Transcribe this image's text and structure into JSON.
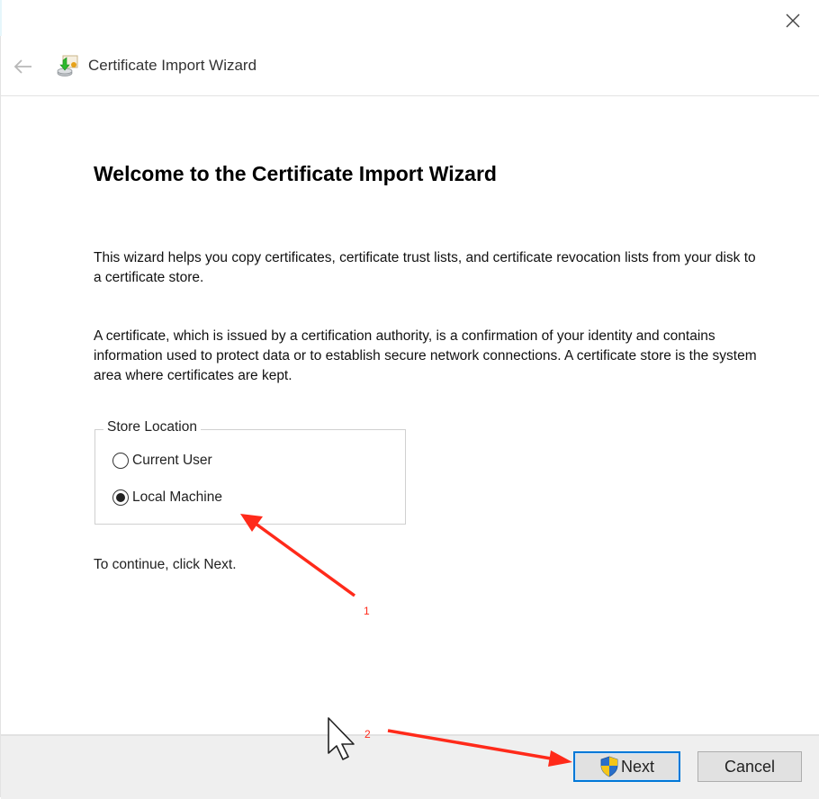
{
  "window": {
    "close_icon": "close-icon"
  },
  "header": {
    "back_icon": "back-arrow-icon",
    "app_icon": "certificate-wizard-icon",
    "title": "Certificate Import Wizard"
  },
  "main": {
    "page_title": "Welcome to the Certificate Import Wizard",
    "paragraph1": "This wizard helps you copy certificates, certificate trust lists, and certificate revocation lists from your disk to a certificate store.",
    "paragraph2": "A certificate, which is issued by a certification authority, is a confirmation of your identity and contains information used to protect data or to establish secure network connections. A certificate store is the system area where certificates are kept.",
    "store_location": {
      "legend": "Store Location",
      "options": [
        {
          "label": "Current User",
          "selected": false
        },
        {
          "label": "Local Machine",
          "selected": true
        }
      ]
    },
    "continue_text": "To continue, click Next."
  },
  "footer": {
    "next_label": "Next",
    "next_icon": "uac-shield-icon",
    "cancel_label": "Cancel"
  },
  "annotations": {
    "step1": "1",
    "step2": "2",
    "color": "#ff2a1a"
  },
  "colors": {
    "accent": "#0078d7",
    "footer_bg": "#efefef",
    "button_bg": "#e1e1e1"
  }
}
